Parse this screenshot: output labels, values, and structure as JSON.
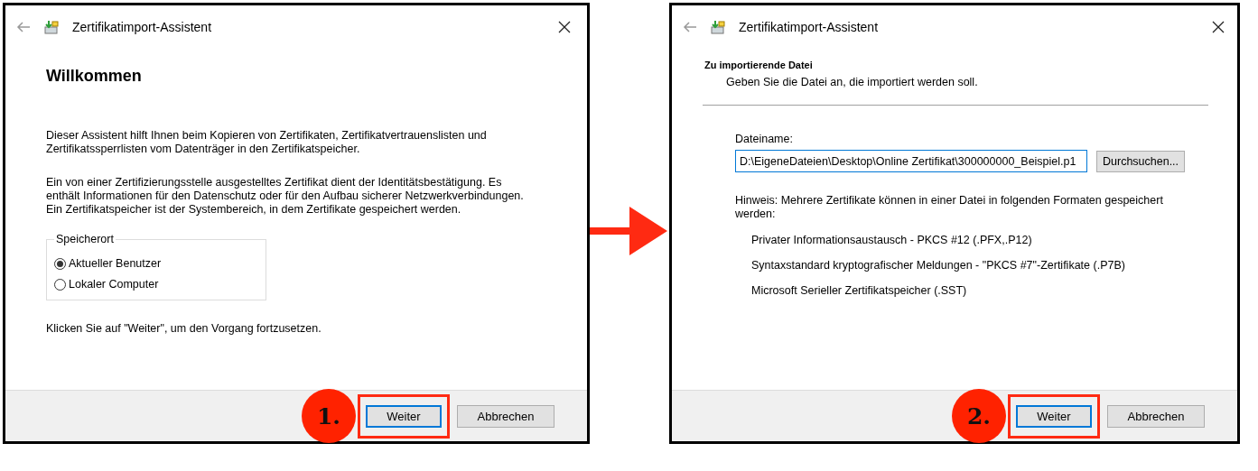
{
  "dialogs": [
    {
      "kind": "welcome",
      "title": "Zertifikatimport-Assistent",
      "heading": "Willkommen",
      "paragraphs": [
        "Dieser Assistent hilft Ihnen beim Kopieren von Zertifikaten, Zertifikatvertrauenslisten und Zertifikatssperrlisten vom Datenträger in den Zertifikatspeicher.",
        "Ein von einer Zertifizierungsstelle ausgestelltes Zertifikat dient der Identitätsbestätigung. Es enthält Informationen für den Datenschutz oder für den Aufbau sicherer Netzwerkverbindungen. Ein Zertifikatspeicher ist der Systembereich, in dem Zertifikate gespeichert werden."
      ],
      "group": {
        "label": "Speicherort",
        "options": [
          {
            "label": "Aktueller Benutzer",
            "selected": true
          },
          {
            "label": "Lokaler Computer",
            "selected": false
          }
        ]
      },
      "footer_text": "Klicken Sie auf \"Weiter\", um den Vorgang fortzusetzen.",
      "step": "1.",
      "buttons": [
        {
          "label": "Weiter",
          "default": true,
          "highlighted": true
        },
        {
          "label": "Abbrechen",
          "default": false,
          "highlighted": false
        }
      ]
    },
    {
      "kind": "file",
      "title": "Zertifikatimport-Assistent",
      "heading": "Zu importierende Datei",
      "subheading": "Geben Sie die Datei an, die importiert werden soll.",
      "field_label": "Dateiname:",
      "field_value": "D:\\EigeneDateien\\Desktop\\Online Zertifikat\\300000000_Beispiel.p1",
      "browse": "Durchsuchen...",
      "note": "Hinweis: Mehrere Zertifikate können in einer Datei in folgenden Formaten gespeichert werden:",
      "formats": [
        "Privater Informationsaustausch - PKCS #12 (.PFX,.P12)",
        "Syntaxstandard kryptografischer Meldungen - \"PKCS #7\"-Zertifikate (.P7B)",
        "Microsoft Serieller Zertifikatspeicher (.SST)"
      ],
      "step": "2.",
      "buttons": [
        {
          "label": "Weiter",
          "default": true,
          "highlighted": true
        },
        {
          "label": "Abbrechen",
          "default": false,
          "highlighted": false
        }
      ]
    }
  ]
}
